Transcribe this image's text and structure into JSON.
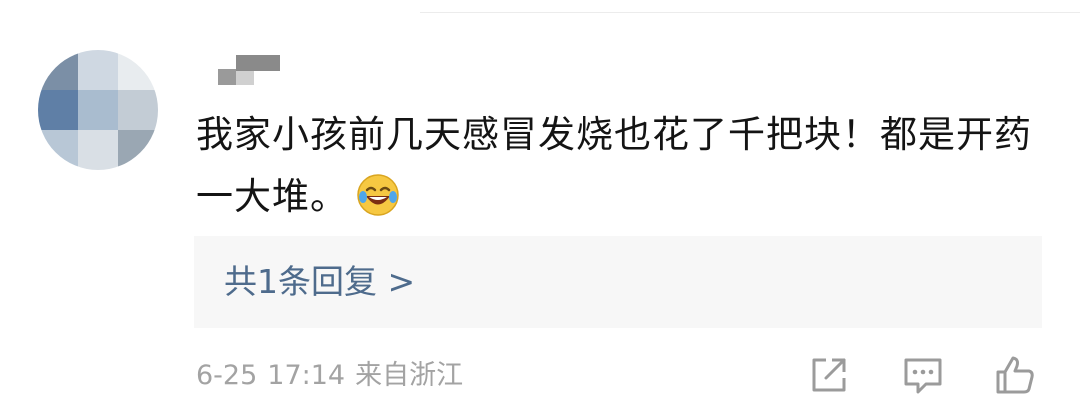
{
  "comment": {
    "text": "我家小孩前几天感冒发烧也花了千把块！都是开药一大堆。",
    "emoji_icon": "laughing-crying-emoji",
    "avatar_icon": "pixelated-avatar",
    "username_icon": "pixelated-username"
  },
  "reply": {
    "label": "共1条回复 >"
  },
  "meta": {
    "date": "6-25",
    "time": "17:14",
    "source": "来自浙江"
  },
  "actions": {
    "share_icon": "share-icon",
    "comment_icon": "comment-icon",
    "like_icon": "thumbs-up-icon"
  },
  "colors": {
    "text": "#141414",
    "link": "#4e6b8c",
    "meta": "#a3a3a3",
    "reply_bg": "#f7f7f7"
  }
}
